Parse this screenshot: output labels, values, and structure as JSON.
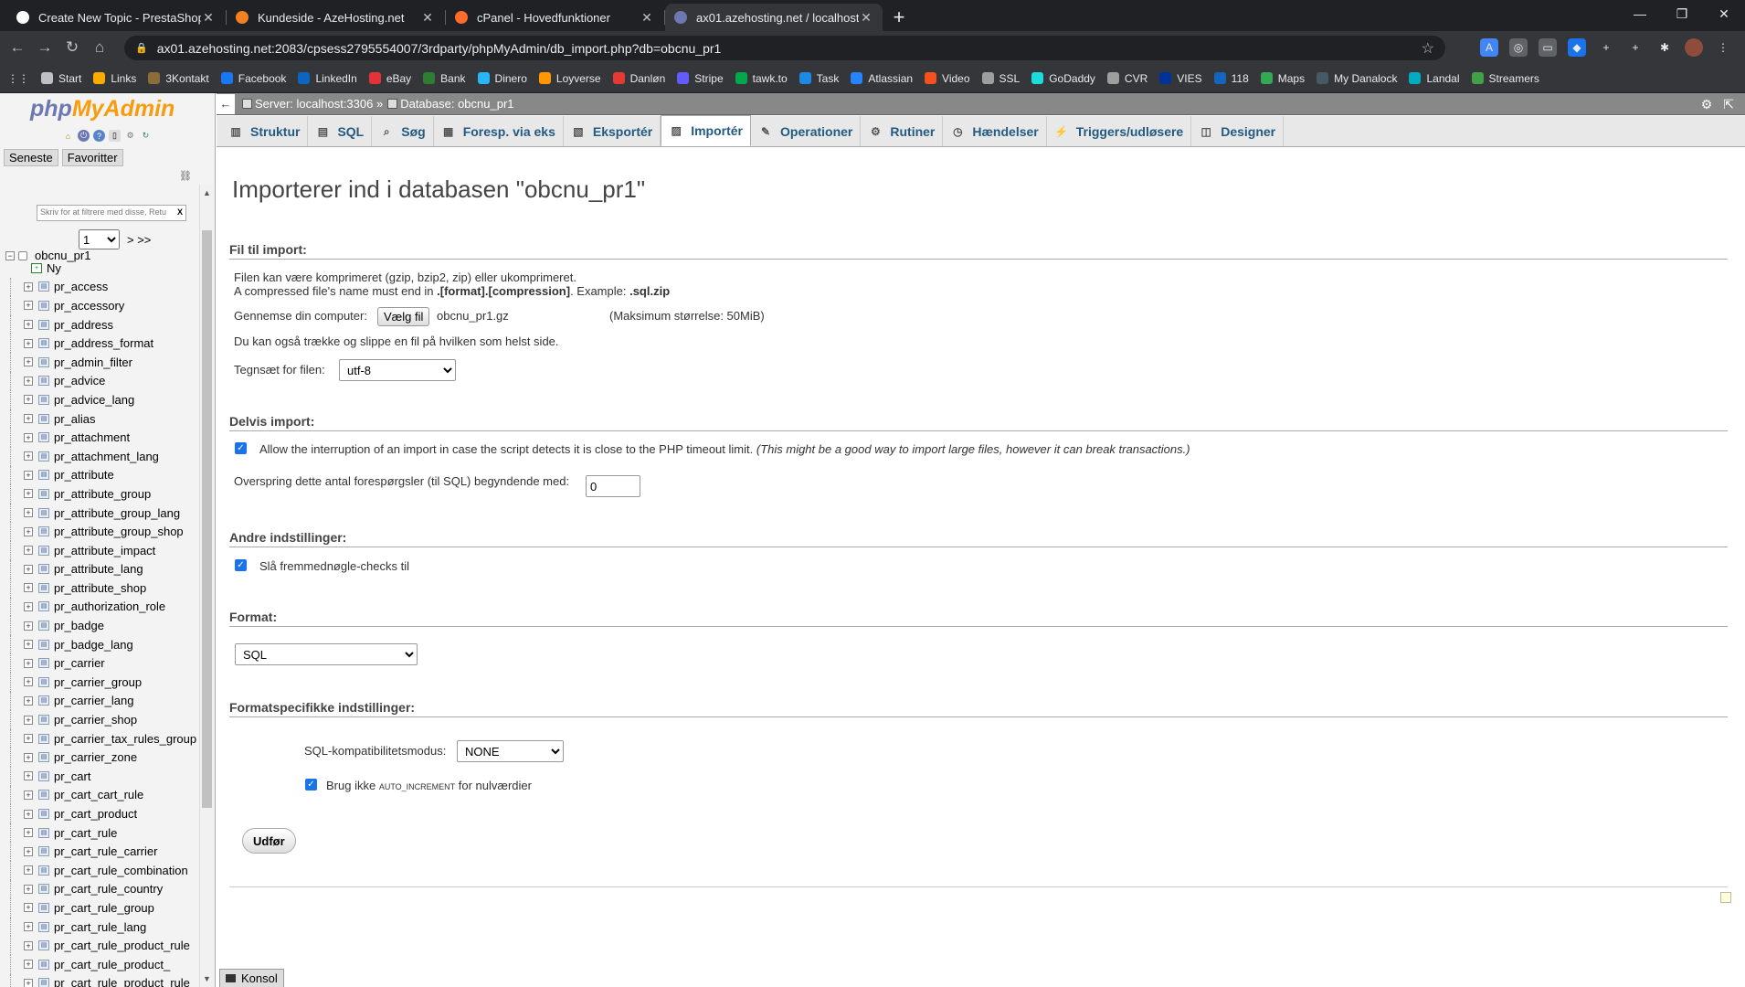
{
  "browser": {
    "tabs": [
      {
        "title": "Create New Topic - PrestaShop F",
        "color": "#ffffff"
      },
      {
        "title": "Kundeside - AzeHosting.net",
        "color": "#f4811f"
      },
      {
        "title": "cPanel - Hovedfunktioner",
        "color": "#ff6c2c"
      },
      {
        "title": "ax01.azehosting.net / localhost /",
        "color": "#6c78af"
      }
    ],
    "new_tab": "+",
    "url": "ax01.azehosting.net:2083/cpsess2795554007/3rdparty/phpMyAdmin/db_import.php?db=obcnu_pr1",
    "bookmarks": [
      {
        "label": "Start",
        "color": "#bdc1c6"
      },
      {
        "label": "Links",
        "color": "#f9ab00"
      },
      {
        "label": "3Kontakt",
        "color": "#8a6d3b"
      },
      {
        "label": "Facebook",
        "color": "#1877f2"
      },
      {
        "label": "LinkedIn",
        "color": "#0a66c2"
      },
      {
        "label": "eBay",
        "color": "#e53238"
      },
      {
        "label": "Bank",
        "color": "#2e7d32"
      },
      {
        "label": "Dinero",
        "color": "#29b6f6"
      },
      {
        "label": "Loyverse",
        "color": "#ff9800"
      },
      {
        "label": "Danløn",
        "color": "#e53935"
      },
      {
        "label": "Stripe",
        "color": "#635bff"
      },
      {
        "label": "tawk.to",
        "color": "#03a84e"
      },
      {
        "label": "Task",
        "color": "#1e88e5"
      },
      {
        "label": "Atlassian",
        "color": "#2684ff"
      },
      {
        "label": "Video",
        "color": "#f4511e"
      },
      {
        "label": "SSL",
        "color": "#9e9e9e"
      },
      {
        "label": "GoDaddy",
        "color": "#1bdbdb"
      },
      {
        "label": "CVR",
        "color": "#9e9e9e"
      },
      {
        "label": "VIES",
        "color": "#003399"
      },
      {
        "label": "118",
        "color": "#1565c0"
      },
      {
        "label": "Maps",
        "color": "#34a853"
      },
      {
        "label": "My Danalock",
        "color": "#455a64"
      },
      {
        "label": "Landal",
        "color": "#00acc1"
      },
      {
        "label": "Streamers",
        "color": "#43a047"
      }
    ]
  },
  "sidebar": {
    "logo_a": "php",
    "logo_b": "MyAdmin",
    "tab_recent": "Seneste",
    "tab_favorites": "Favoritter",
    "db_name": "obcnu_pr1",
    "filter_placeholder": "Skriv for at filtrere med disse, Retu",
    "filter_clear": "X",
    "page_value": "1",
    "page_next": "> >>",
    "new_label": "Ny",
    "tables": [
      "pr_access",
      "pr_accessory",
      "pr_address",
      "pr_address_format",
      "pr_admin_filter",
      "pr_advice",
      "pr_advice_lang",
      "pr_alias",
      "pr_attachment",
      "pr_attachment_lang",
      "pr_attribute",
      "pr_attribute_group",
      "pr_attribute_group_lang",
      "pr_attribute_group_shop",
      "pr_attribute_impact",
      "pr_attribute_lang",
      "pr_attribute_shop",
      "pr_authorization_role",
      "pr_badge",
      "pr_badge_lang",
      "pr_carrier",
      "pr_carrier_group",
      "pr_carrier_lang",
      "pr_carrier_shop",
      "pr_carrier_tax_rules_group",
      "pr_carrier_zone",
      "pr_cart",
      "pr_cart_cart_rule",
      "pr_cart_product",
      "pr_cart_rule",
      "pr_cart_rule_carrier",
      "pr_cart_rule_combination",
      "pr_cart_rule_country",
      "pr_cart_rule_group",
      "pr_cart_rule_lang",
      "pr_cart_rule_product_rule",
      "pr_cart_rule_product_",
      "pr_cart_rule_product_rule"
    ]
  },
  "breadcrumb": {
    "back": "←",
    "server": "Server: localhost:3306 »",
    "database": "Database: obcnu_pr1"
  },
  "menu": [
    {
      "label": "Struktur",
      "icon": "structure-icon",
      "glyph": "▥"
    },
    {
      "label": "SQL",
      "icon": "sql-icon",
      "glyph": "▤"
    },
    {
      "label": "Søg",
      "icon": "search-icon",
      "glyph": "⌕"
    },
    {
      "label": "Foresp. via eks",
      "icon": "query-icon",
      "glyph": "▦"
    },
    {
      "label": "Eksportér",
      "icon": "export-icon",
      "glyph": "▧"
    },
    {
      "label": "Importér",
      "icon": "import-icon",
      "glyph": "▨",
      "active": true
    },
    {
      "label": "Operationer",
      "icon": "wrench-icon",
      "glyph": "✎"
    },
    {
      "label": "Rutiner",
      "icon": "routines-icon",
      "glyph": "⚙"
    },
    {
      "label": "Hændelser",
      "icon": "clock-icon",
      "glyph": "◷"
    },
    {
      "label": "Triggers/udløsere",
      "icon": "triggers-icon",
      "glyph": "⚡"
    },
    {
      "label": "Designer",
      "icon": "designer-icon",
      "glyph": "◫"
    }
  ],
  "page": {
    "title": "Importerer ind i databasen \"obcnu_pr1\"",
    "file_section": "Fil til import:",
    "compress_line1": "Filen kan være komprimeret (gzip, bzip2, zip) eller ukomprimeret.",
    "compress_line2a": "A compressed file's name must end in ",
    "compress_line2b": ".[format].[compression]",
    "compress_line2c": ". Example: ",
    "compress_line2d": ".sql.zip",
    "browse_label": "Gennemse din computer:",
    "choose_file": "Vælg fil",
    "chosen_file": "obcnu_pr1.gz",
    "max_size": "(Maksimum størrelse: 50MiB)",
    "drag_hint": "Du kan også trække og slippe en fil på hvilken som helst side.",
    "charset_label": "Tegnsæt for filen:",
    "charset_value": "utf-8",
    "partial_section": "Delvis import:",
    "allow_interrupt": "Allow the interruption of an import in case the script detects it is close to the PHP timeout limit.",
    "allow_interrupt_note": "(This might be a good way to import large files, however it can break transactions.)",
    "skip_label": "Overspring dette antal forespørgsler (til SQL) begyndende med:",
    "skip_value": "0",
    "other_section": "Andre indstillinger:",
    "fk_checks": "Slå fremmednøgle-checks til",
    "format_section": "Format:",
    "format_value": "SQL",
    "format_specific_section": "Formatspecifikke indstillinger:",
    "sql_compat_label": "SQL-kompatibilitetsmodus:",
    "sql_compat_value": "NONE",
    "no_auto_inc_a": "Brug ikke ",
    "no_auto_inc_b": "AUTO_INCREMENT",
    "no_auto_inc_c": " for nulværdier",
    "submit": "Udfør",
    "console": "Konsol"
  }
}
